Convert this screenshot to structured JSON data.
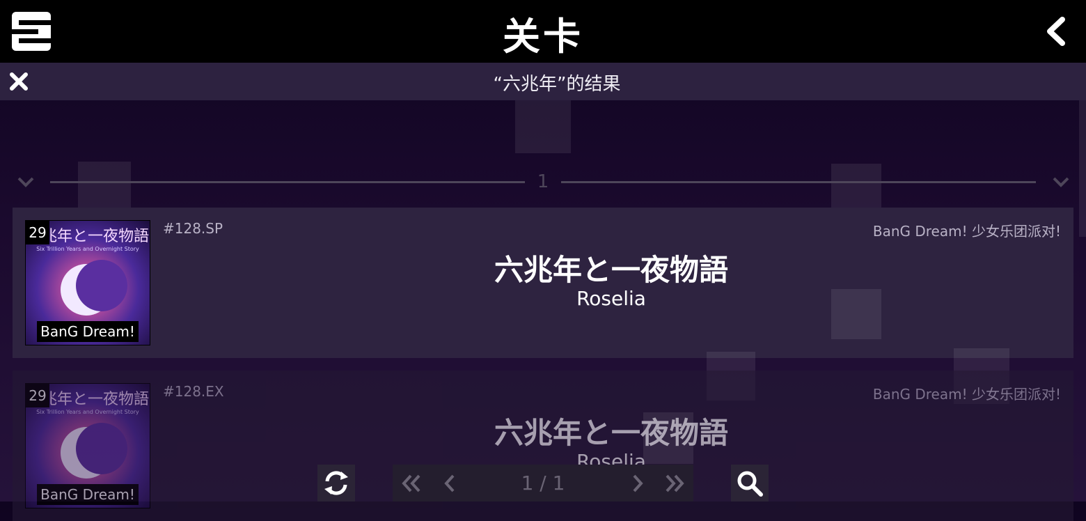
{
  "header": {
    "title": "关卡",
    "logo_icon": "app-s-logo",
    "back_icon": "chevron-left-icon"
  },
  "search": {
    "result_text": "“六兆年”的结果",
    "close_icon": "close-icon"
  },
  "group": {
    "label": "1"
  },
  "cards": [
    {
      "level": "29",
      "code": "#128.SP",
      "source": "BanG Dream! 少女乐团派对!",
      "title": "六兆年と一夜物語",
      "artist": "Roselia",
      "cover_title": "六兆年と一夜物語",
      "cover_subtitle": "Six Trillion Years and Overnight Story",
      "cover_brand": "BanG Dream!"
    },
    {
      "level": "29",
      "code": "#128.EX",
      "source": "BanG Dream! 少女乐团派对!",
      "title": "六兆年と一夜物語",
      "artist": "Roselia",
      "cover_title": "六兆年と一夜物語",
      "cover_subtitle": "Six Trillion Years and Overnight Story",
      "cover_brand": "BanG Dream!"
    }
  ],
  "pagination": {
    "text": "1 / 1"
  },
  "colors": {
    "topbar": "#000000",
    "card_bg": "#2e2340",
    "muted_text": "#b9b2c6"
  }
}
